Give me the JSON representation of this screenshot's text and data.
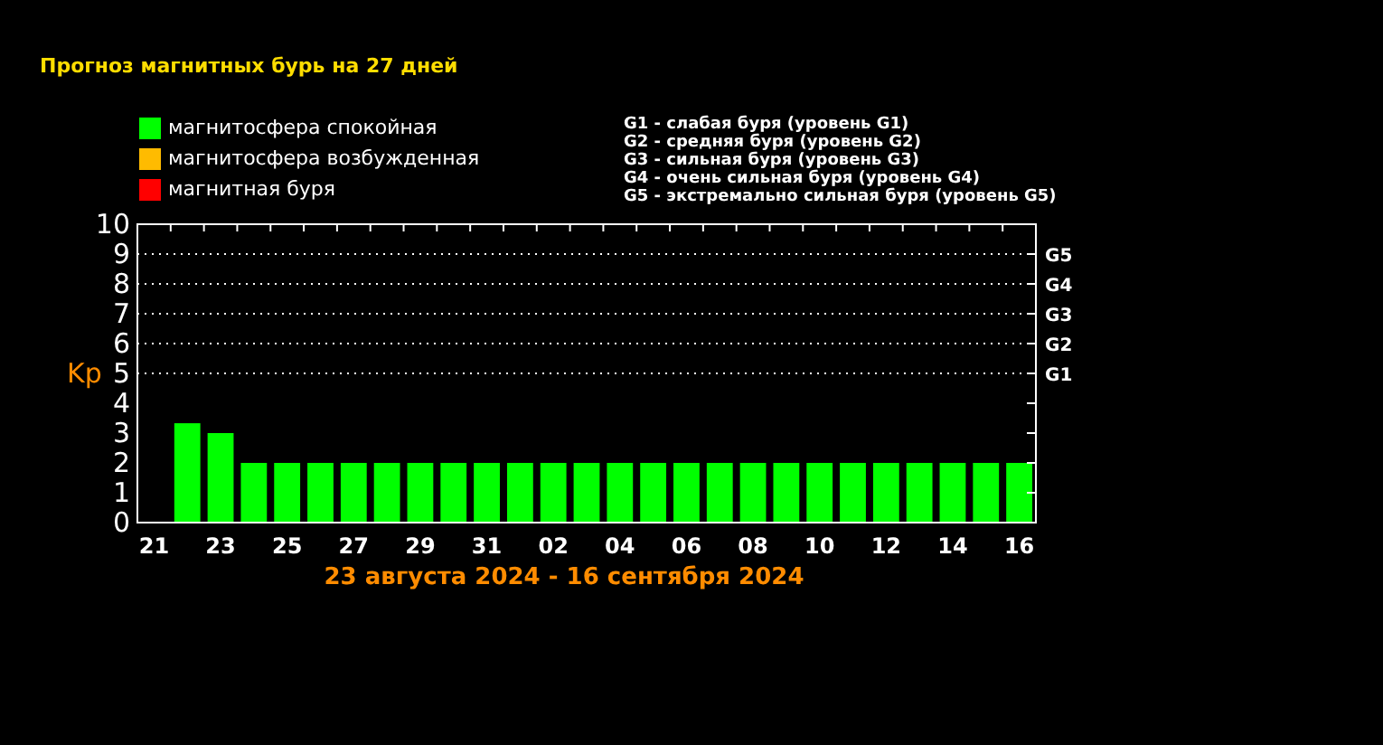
{
  "title": "Прогноз магнитных бурь на 27 дней",
  "legend": [
    {
      "label": "магнитосфера спокойная",
      "color": "#00ff00"
    },
    {
      "label": "магнитосфера возбужденная",
      "color": "#ffbb00"
    },
    {
      "label": "магнитная буря",
      "color": "#ff0000"
    }
  ],
  "storm_levels": [
    "G1 - слабая буря (уровень G1)",
    "G2 - средняя буря (уровень G2)",
    "G3 - сильная буря (уровень G3)",
    "G4 - очень сильная буря (уровень G4)",
    "G5 - экстремально сильная буря (уровень G5)"
  ],
  "chart_data": {
    "type": "bar",
    "ylabel": "Kp",
    "xlabel": "23 августа 2024 - 16 сентября 2024",
    "categories": [
      "21",
      null,
      "23",
      null,
      "25",
      null,
      "27",
      null,
      "29",
      null,
      "31",
      null,
      "02",
      null,
      "04",
      null,
      "06",
      null,
      "08",
      null,
      "10",
      null,
      "12",
      null,
      "14",
      null,
      "16"
    ],
    "grid": "y",
    "series": [
      {
        "color": "#00ff00",
        "values": [
          null,
          3.33,
          3,
          2,
          2,
          2,
          2,
          2,
          2,
          2,
          2,
          2,
          2,
          2,
          2,
          2,
          2,
          2,
          2,
          2,
          2,
          2,
          2,
          2,
          2,
          2,
          2
        ]
      }
    ],
    "ylim": [
      0,
      10
    ],
    "yticks": [
      0,
      1,
      2,
      3,
      4,
      5,
      6,
      7,
      8,
      9,
      10
    ],
    "annotations": [
      "G1",
      "G2",
      "G3",
      "G4",
      "G5"
    ]
  }
}
